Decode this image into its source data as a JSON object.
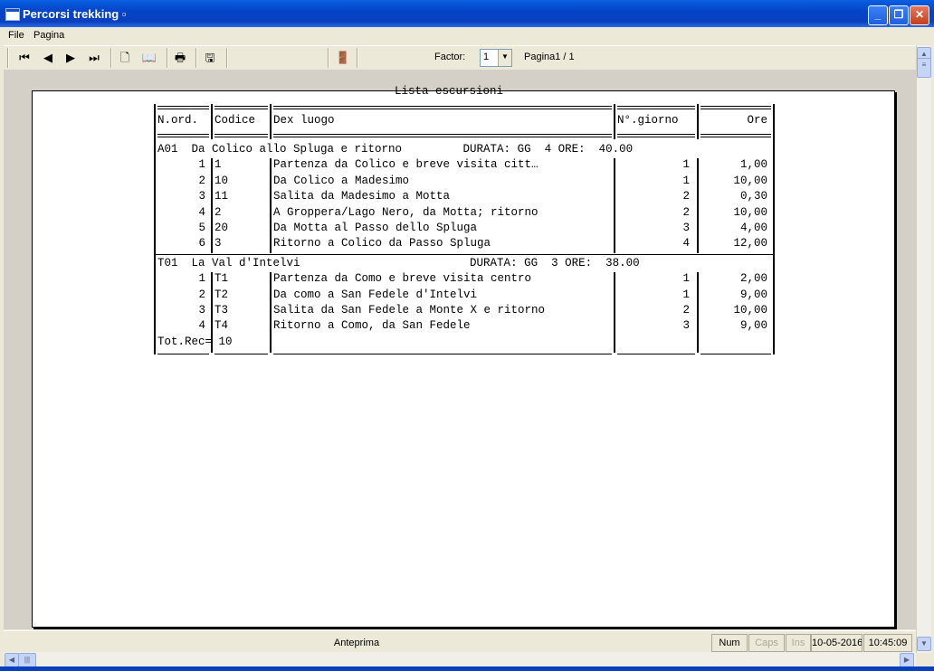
{
  "window": {
    "title": "Percorsi trekking ▫"
  },
  "menu": {
    "file": "File",
    "pagina": "Pagina"
  },
  "toolbar": {
    "factor_label": "Factor:",
    "factor_value": "1",
    "page_label": "Pagina1 / 1"
  },
  "report": {
    "title": "Lista escursioni",
    "headers": {
      "nord": "N.ord.",
      "codice": "Codice",
      "dex": "Dex luogo",
      "giorno": "N°.giorno",
      "ore": "Ore"
    },
    "groups": [
      {
        "header": "A01  Da Colico allo Spluga e ritorno         DURATA: GG  4 ORE:  40.00",
        "rows": [
          {
            "n": "1",
            "code": "1",
            "dex": "Partenza da Colico e breve visita citt…",
            "giorno": "1",
            "ore": "1,00"
          },
          {
            "n": "2",
            "code": "10",
            "dex": "Da Colico a Madesimo",
            "giorno": "1",
            "ore": "10,00"
          },
          {
            "n": "3",
            "code": "11",
            "dex": "Salita da Madesimo a Motta",
            "giorno": "2",
            "ore": "0,30"
          },
          {
            "n": "4",
            "code": "2",
            "dex": "A Groppera/Lago Nero, da Motta; ritorno",
            "giorno": "2",
            "ore": "10,00"
          },
          {
            "n": "5",
            "code": "20",
            "dex": "Da Motta al Passo dello Spluga",
            "giorno": "3",
            "ore": "4,00"
          },
          {
            "n": "6",
            "code": "3",
            "dex": "Ritorno a Colico da Passo Spluga",
            "giorno": "4",
            "ore": "12,00"
          }
        ]
      },
      {
        "header": "T01  La Val d'Intelvi                         DURATA: GG  3 ORE:  38.00",
        "rows": [
          {
            "n": "1",
            "code": "T1",
            "dex": "Partenza da Como e breve visita centro",
            "giorno": "1",
            "ore": "2,00"
          },
          {
            "n": "2",
            "code": "T2",
            "dex": "Da como a San Fedele d'Intelvi",
            "giorno": "1",
            "ore": "9,00"
          },
          {
            "n": "3",
            "code": "T3",
            "dex": "Salita da San Fedele a Monte X e ritorno",
            "giorno": "2",
            "ore": "10,00"
          },
          {
            "n": "4",
            "code": "T4",
            "dex": "Ritorno a Como, da San Fedele",
            "giorno": "3",
            "ore": "9,00"
          }
        ]
      }
    ],
    "total": "Tot.Rec= 10"
  },
  "status": {
    "mode": "Anteprima",
    "num": "Num",
    "caps": "Caps",
    "ins": "Ins",
    "date": "10-05-2016",
    "time": "10:45:09"
  },
  "colors": {
    "titlebar": "#0a3fbd",
    "face": "#ece9d8",
    "disabled": "#aca899"
  }
}
